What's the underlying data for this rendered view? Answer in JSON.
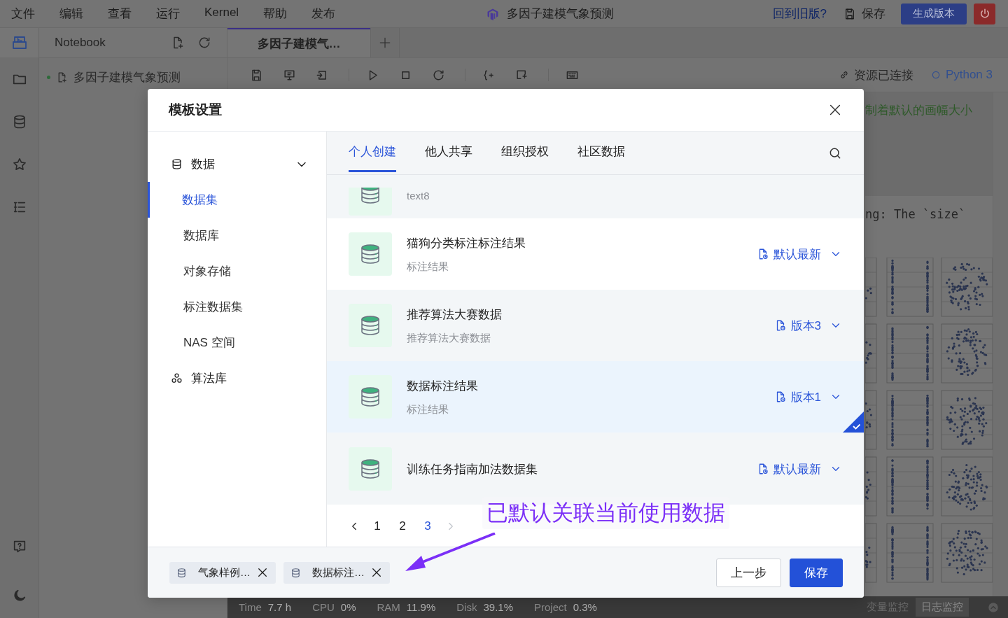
{
  "menu_bar": {
    "items": [
      "文件",
      "编辑",
      "查看",
      "运行",
      "Kernel",
      "帮助",
      "发布"
    ],
    "title": "多因子建模气象预测",
    "old_version_link": "回到旧版?",
    "save": "保存",
    "publish_button": "生成版本"
  },
  "file_panel": {
    "title": "Notebook",
    "files": [
      {
        "name": "多因子建模气象预测"
      }
    ]
  },
  "notebook_tabs": [
    {
      "label": "多因子建模气…",
      "selected": true
    }
  ],
  "kernel_status": {
    "resource": "资源已连接",
    "kernel": "Python 3"
  },
  "output": {
    "note": "制着默认的画幅大小",
    "warning": "ng: The `size`"
  },
  "status_bar": {
    "metrics": [
      {
        "label": "Time",
        "value": "7.7 h"
      },
      {
        "label": "CPU",
        "value": "0%"
      },
      {
        "label": "RAM",
        "value": "11.9%"
      },
      {
        "label": "Disk",
        "value": "39.1%"
      },
      {
        "label": "Project",
        "value": "0.3%"
      }
    ],
    "panels": [
      {
        "label": "变量监控",
        "selected": false
      },
      {
        "label": "日志监控",
        "selected": true
      }
    ]
  },
  "modal": {
    "title": "模板设置",
    "nav": [
      {
        "label": "数据",
        "kind": "database",
        "expanded": true,
        "children": [
          {
            "label": "数据集",
            "selected": true
          },
          {
            "label": "数据库",
            "selected": false
          },
          {
            "label": "对象存储",
            "selected": false
          },
          {
            "label": "标注数据集",
            "selected": false
          },
          {
            "label": "NAS 空间",
            "selected": false
          }
        ]
      },
      {
        "label": "算法库",
        "kind": "cluster"
      }
    ],
    "tabs": [
      {
        "label": "个人创建",
        "selected": true
      },
      {
        "label": "他人共享",
        "selected": false
      },
      {
        "label": "组织授权",
        "selected": false
      },
      {
        "label": "社区数据",
        "selected": false
      }
    ],
    "rows": [
      {
        "kind": "clipped",
        "description": "text8",
        "selected": false,
        "highlighted": false
      },
      {
        "kind": "full",
        "name": "猫狗分类标注标注结果",
        "description": "标注结果",
        "version": "默认最新",
        "selected": false,
        "highlighted": true
      },
      {
        "kind": "full",
        "name": "推荐算法大赛数据",
        "description": "推荐算法大赛数据",
        "version": "版本3",
        "selected": false,
        "highlighted": false
      },
      {
        "kind": "full",
        "name": "数据标注结果",
        "description": "标注结果",
        "version": "版本1",
        "selected": true,
        "highlighted": false
      },
      {
        "kind": "full",
        "name": "训练任务指南加法数据集",
        "version": "默认最新",
        "selected": false,
        "highlighted": false
      }
    ],
    "pagination": {
      "pages": [
        {
          "label": "1",
          "selected": false
        },
        {
          "label": "2",
          "selected": false
        },
        {
          "label": "3",
          "selected": true
        }
      ],
      "prev_disabled": false,
      "next_disabled": true
    },
    "annotation": "已默认关联当前使用数据",
    "chips": [
      {
        "label": "气象样例…"
      },
      {
        "label": "数据标注…"
      }
    ],
    "buttons": [
      {
        "label": "上一步",
        "kind": "secondary"
      },
      {
        "label": "保存",
        "kind": "primary"
      }
    ]
  }
}
